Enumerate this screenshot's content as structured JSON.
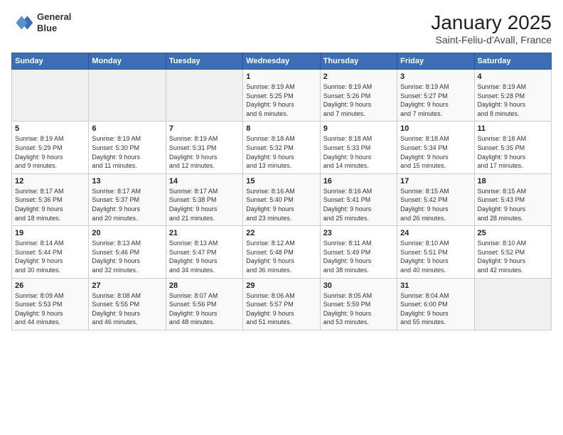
{
  "logo": {
    "line1": "General",
    "line2": "Blue"
  },
  "title": "January 2025",
  "subtitle": "Saint-Feliu-d'Avall, France",
  "days_header": [
    "Sunday",
    "Monday",
    "Tuesday",
    "Wednesday",
    "Thursday",
    "Friday",
    "Saturday"
  ],
  "weeks": [
    [
      {
        "day": "",
        "info": ""
      },
      {
        "day": "",
        "info": ""
      },
      {
        "day": "",
        "info": ""
      },
      {
        "day": "1",
        "info": "Sunrise: 8:19 AM\nSunset: 5:25 PM\nDaylight: 9 hours\nand 6 minutes."
      },
      {
        "day": "2",
        "info": "Sunrise: 8:19 AM\nSunset: 5:26 PM\nDaylight: 9 hours\nand 7 minutes."
      },
      {
        "day": "3",
        "info": "Sunrise: 8:19 AM\nSunset: 5:27 PM\nDaylight: 9 hours\nand 7 minutes."
      },
      {
        "day": "4",
        "info": "Sunrise: 8:19 AM\nSunset: 5:28 PM\nDaylight: 9 hours\nand 8 minutes."
      }
    ],
    [
      {
        "day": "5",
        "info": "Sunrise: 8:19 AM\nSunset: 5:29 PM\nDaylight: 9 hours\nand 9 minutes."
      },
      {
        "day": "6",
        "info": "Sunrise: 8:19 AM\nSunset: 5:30 PM\nDaylight: 9 hours\nand 11 minutes."
      },
      {
        "day": "7",
        "info": "Sunrise: 8:19 AM\nSunset: 5:31 PM\nDaylight: 9 hours\nand 12 minutes."
      },
      {
        "day": "8",
        "info": "Sunrise: 8:18 AM\nSunset: 5:32 PM\nDaylight: 9 hours\nand 13 minutes."
      },
      {
        "day": "9",
        "info": "Sunrise: 8:18 AM\nSunset: 5:33 PM\nDaylight: 9 hours\nand 14 minutes."
      },
      {
        "day": "10",
        "info": "Sunrise: 8:18 AM\nSunset: 5:34 PM\nDaylight: 9 hours\nand 15 minutes."
      },
      {
        "day": "11",
        "info": "Sunrise: 8:18 AM\nSunset: 5:35 PM\nDaylight: 9 hours\nand 17 minutes."
      }
    ],
    [
      {
        "day": "12",
        "info": "Sunrise: 8:17 AM\nSunset: 5:36 PM\nDaylight: 9 hours\nand 18 minutes."
      },
      {
        "day": "13",
        "info": "Sunrise: 8:17 AM\nSunset: 5:37 PM\nDaylight: 9 hours\nand 20 minutes."
      },
      {
        "day": "14",
        "info": "Sunrise: 8:17 AM\nSunset: 5:38 PM\nDaylight: 9 hours\nand 21 minutes."
      },
      {
        "day": "15",
        "info": "Sunrise: 8:16 AM\nSunset: 5:40 PM\nDaylight: 9 hours\nand 23 minutes."
      },
      {
        "day": "16",
        "info": "Sunrise: 8:16 AM\nSunset: 5:41 PM\nDaylight: 9 hours\nand 25 minutes."
      },
      {
        "day": "17",
        "info": "Sunrise: 8:15 AM\nSunset: 5:42 PM\nDaylight: 9 hours\nand 26 minutes."
      },
      {
        "day": "18",
        "info": "Sunrise: 8:15 AM\nSunset: 5:43 PM\nDaylight: 9 hours\nand 28 minutes."
      }
    ],
    [
      {
        "day": "19",
        "info": "Sunrise: 8:14 AM\nSunset: 5:44 PM\nDaylight: 9 hours\nand 30 minutes."
      },
      {
        "day": "20",
        "info": "Sunrise: 8:13 AM\nSunset: 5:46 PM\nDaylight: 9 hours\nand 32 minutes."
      },
      {
        "day": "21",
        "info": "Sunrise: 8:13 AM\nSunset: 5:47 PM\nDaylight: 9 hours\nand 34 minutes."
      },
      {
        "day": "22",
        "info": "Sunrise: 8:12 AM\nSunset: 5:48 PM\nDaylight: 9 hours\nand 36 minutes."
      },
      {
        "day": "23",
        "info": "Sunrise: 8:11 AM\nSunset: 5:49 PM\nDaylight: 9 hours\nand 38 minutes."
      },
      {
        "day": "24",
        "info": "Sunrise: 8:10 AM\nSunset: 5:51 PM\nDaylight: 9 hours\nand 40 minutes."
      },
      {
        "day": "25",
        "info": "Sunrise: 8:10 AM\nSunset: 5:52 PM\nDaylight: 9 hours\nand 42 minutes."
      }
    ],
    [
      {
        "day": "26",
        "info": "Sunrise: 8:09 AM\nSunset: 5:53 PM\nDaylight: 9 hours\nand 44 minutes."
      },
      {
        "day": "27",
        "info": "Sunrise: 8:08 AM\nSunset: 5:55 PM\nDaylight: 9 hours\nand 46 minutes."
      },
      {
        "day": "28",
        "info": "Sunrise: 8:07 AM\nSunset: 5:56 PM\nDaylight: 9 hours\nand 48 minutes."
      },
      {
        "day": "29",
        "info": "Sunrise: 8:06 AM\nSunset: 5:57 PM\nDaylight: 9 hours\nand 51 minutes."
      },
      {
        "day": "30",
        "info": "Sunrise: 8:05 AM\nSunset: 5:59 PM\nDaylight: 9 hours\nand 53 minutes."
      },
      {
        "day": "31",
        "info": "Sunrise: 8:04 AM\nSunset: 6:00 PM\nDaylight: 9 hours\nand 55 minutes."
      },
      {
        "day": "",
        "info": ""
      }
    ]
  ]
}
